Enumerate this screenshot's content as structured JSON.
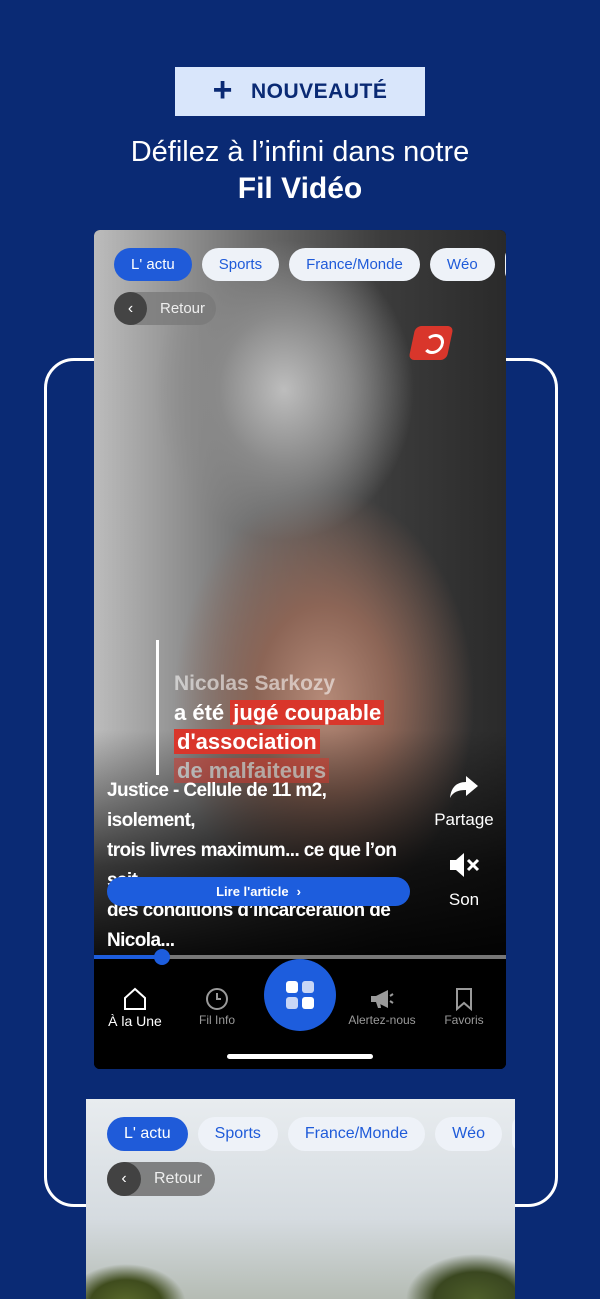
{
  "badge": {
    "icon": "plus-icon",
    "label": "NOUVEAUTÉ"
  },
  "headline": {
    "line1": "Défilez à l’infini dans notre",
    "line2": "Fil Vidéo"
  },
  "phone": {
    "chips": [
      "L' actu",
      "Sports",
      "France/Monde",
      "Wéo"
    ],
    "active_chip": "L' actu",
    "back_label": "Retour",
    "overlay": {
      "name": "Nicolas Sarkozy",
      "line_a_plain": "a été ",
      "line_a_highlight": "jugé coupable",
      "line_b": "d'association",
      "line_c": "de malfaiteurs"
    },
    "story": {
      "line1": "Justice - Cellule de 11 m2, isolement,",
      "line2": "trois livres maximum... ce que l’on sait",
      "line3": "des conditions d’incarcération de Nicola..."
    },
    "read_button": "Lire l'article",
    "share_label": "Partage",
    "sound_label": "Son",
    "progress": 0.165,
    "tabs": [
      {
        "label": "À la Une",
        "icon": "home-icon"
      },
      {
        "label": "Fil Info",
        "icon": "clock-icon"
      },
      {
        "label": "",
        "icon": "grid-icon"
      },
      {
        "label": "Alertez-nous",
        "icon": "megaphone-icon"
      },
      {
        "label": "Favoris",
        "icon": "bookmark-icon"
      }
    ]
  },
  "phone2": {
    "chips": [
      "L' actu",
      "Sports",
      "France/Monde",
      "Wéo"
    ],
    "back_label": "Retour"
  },
  "colors": {
    "background": "#0a2a74",
    "accent": "#1d5ddd",
    "highlight": "#d9362b"
  }
}
